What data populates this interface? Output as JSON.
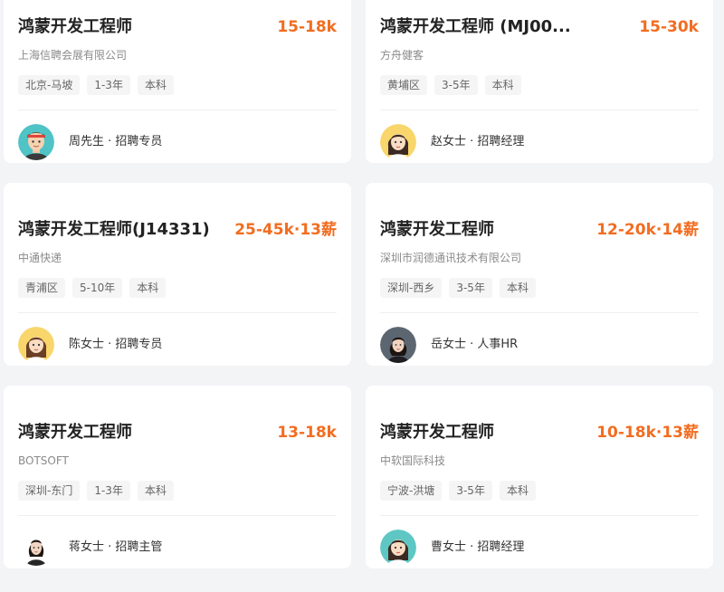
{
  "jobs": [
    {
      "title": "鸿蒙开发工程师",
      "salary": "15-18k",
      "company": "上海信聘会展有限公司",
      "tags": [
        "北京-马坡",
        "1-3年",
        "本科"
      ],
      "recruiter": "周先生 · 招聘专员",
      "avatar": "cartoon-man-avatar"
    },
    {
      "title": "鸿蒙开发工程师 (MJ00...",
      "salary": "15-30k",
      "company": "方舟健客",
      "tags": [
        "黄埔区",
        "3-5年",
        "本科"
      ],
      "recruiter": "赵女士 · 招聘经理",
      "avatar": "cartoon-woman-avatar"
    },
    {
      "title": "鸿蒙开发工程师(J14331)",
      "salary": "25-45k·13薪",
      "company": "中通快递",
      "tags": [
        "青浦区",
        "5-10年",
        "本科"
      ],
      "recruiter": "陈女士 · 招聘专员",
      "avatar": "cartoon-woman-avatar"
    },
    {
      "title": "鸿蒙开发工程师",
      "salary": "12-20k·14薪",
      "company": "深圳市润德通讯技术有限公司",
      "tags": [
        "深圳-西乡",
        "3-5年",
        "本科"
      ],
      "recruiter": "岳女士 · 人事HR",
      "avatar": "photo-woman-avatar"
    },
    {
      "title": "鸿蒙开发工程师",
      "salary": "13-18k",
      "company": "BOTSOFT",
      "tags": [
        "深圳-东门",
        "1-3年",
        "本科"
      ],
      "recruiter": "蒋女士 · 招聘主管",
      "avatar": "photo-woman-avatar"
    },
    {
      "title": "鸿蒙开发工程师",
      "salary": "10-18k·13薪",
      "company": "中软国际科技",
      "tags": [
        "宁波-洪塘",
        "3-5年",
        "本科"
      ],
      "recruiter": "曹女士 · 招聘经理",
      "avatar": "cartoon-woman-avatar"
    }
  ],
  "colors": {
    "salary": "#f26d21",
    "title": "#222222",
    "tag_bg": "#f5f5f5",
    "page_bg": "#f3f4f6"
  }
}
